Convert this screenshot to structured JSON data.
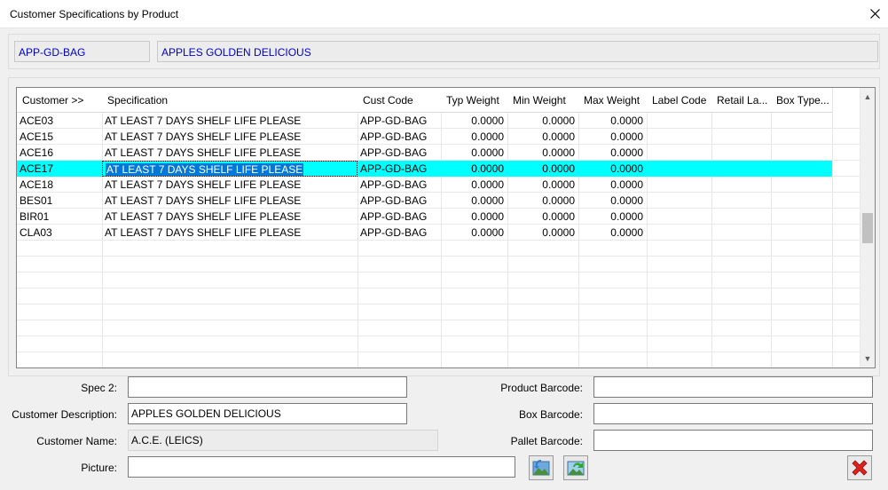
{
  "window": {
    "title": "Customer Specifications by Product",
    "close_icon": "close-icon"
  },
  "product": {
    "code": "APP-GD-BAG",
    "name": "APPLES GOLDEN DELICIOUS"
  },
  "grid": {
    "columns": [
      "Customer >>",
      "Specification",
      "Cust Code",
      "Typ Weight",
      "Min Weight",
      "Max Weight",
      "Label Code",
      "Retail La...",
      "Box Type..."
    ],
    "rows": [
      {
        "customer": "ACE03",
        "specification": "AT LEAST 7 DAYS SHELF LIFE PLEASE",
        "cust_code": "APP-GD-BAG",
        "typ_weight": "0.0000",
        "min_weight": "0.0000",
        "max_weight": "0.0000",
        "label_code": "",
        "retail_label": "",
        "box_type": ""
      },
      {
        "customer": "ACE15",
        "specification": "AT LEAST 7 DAYS SHELF LIFE PLEASE",
        "cust_code": "APP-GD-BAG",
        "typ_weight": "0.0000",
        "min_weight": "0.0000",
        "max_weight": "0.0000",
        "label_code": "",
        "retail_label": "",
        "box_type": ""
      },
      {
        "customer": "ACE16",
        "specification": "AT LEAST 7 DAYS SHELF LIFE PLEASE",
        "cust_code": "APP-GD-BAG",
        "typ_weight": "0.0000",
        "min_weight": "0.0000",
        "max_weight": "0.0000",
        "label_code": "",
        "retail_label": "",
        "box_type": ""
      },
      {
        "customer": "ACE17",
        "specification": "AT LEAST 7 DAYS SHELF LIFE PLEASE",
        "cust_code": "APP-GD-BAG",
        "typ_weight": "0.0000",
        "min_weight": "0.0000",
        "max_weight": "0.0000",
        "label_code": "",
        "retail_label": "",
        "box_type": ""
      },
      {
        "customer": "ACE18",
        "specification": "AT LEAST 7 DAYS SHELF LIFE PLEASE",
        "cust_code": "APP-GD-BAG",
        "typ_weight": "0.0000",
        "min_weight": "0.0000",
        "max_weight": "0.0000",
        "label_code": "",
        "retail_label": "",
        "box_type": ""
      },
      {
        "customer": "BES01",
        "specification": "AT LEAST 7 DAYS SHELF LIFE PLEASE",
        "cust_code": "APP-GD-BAG",
        "typ_weight": "0.0000",
        "min_weight": "0.0000",
        "max_weight": "0.0000",
        "label_code": "",
        "retail_label": "",
        "box_type": ""
      },
      {
        "customer": "BIR01",
        "specification": "AT LEAST 7 DAYS SHELF LIFE PLEASE",
        "cust_code": "APP-GD-BAG",
        "typ_weight": "0.0000",
        "min_weight": "0.0000",
        "max_weight": "0.0000",
        "label_code": "",
        "retail_label": "",
        "box_type": ""
      },
      {
        "customer": "CLA03",
        "specification": "AT LEAST 7 DAYS SHELF LIFE PLEASE",
        "cust_code": "APP-GD-BAG",
        "typ_weight": "0.0000",
        "min_weight": "0.0000",
        "max_weight": "0.0000",
        "label_code": "",
        "retail_label": "",
        "box_type": ""
      }
    ],
    "selected_row": 3,
    "selected_color": "#00ffff",
    "text_selection_color": "#0078d7"
  },
  "form": {
    "spec2": {
      "label": "Spec 2:",
      "value": ""
    },
    "customer_description": {
      "label": "Customer Description:",
      "value": "APPLES GOLDEN DELICIOUS"
    },
    "customer_name": {
      "label": "Customer Name:",
      "value": "A.C.E.  (LEICS)"
    },
    "picture": {
      "label": "Picture:",
      "value": ""
    },
    "product_barcode": {
      "label": "Product Barcode:",
      "value": ""
    },
    "box_barcode": {
      "label": "Box Barcode:",
      "value": ""
    },
    "pallet_barcode": {
      "label": "Pallet Barcode:",
      "value": ""
    }
  },
  "buttons": {
    "load_picture_icon": "picture-load-icon",
    "refresh_picture_icon": "picture-refresh-icon",
    "delete_icon": "red-x-delete-icon"
  },
  "colors": {
    "product_text": "#0000cc",
    "delete_red": "#e0201c",
    "window_bg": "#f0f0f0"
  }
}
